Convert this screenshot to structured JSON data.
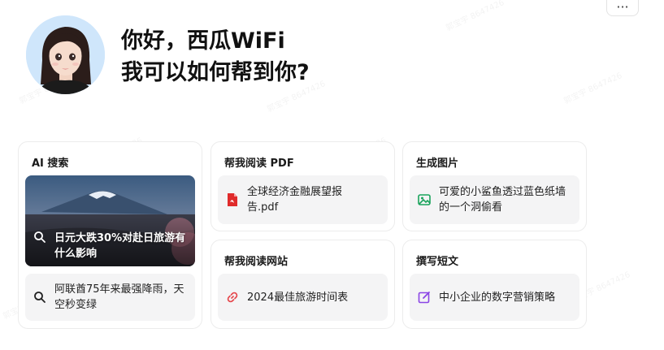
{
  "header": {
    "greeting_line1": "你好，西瓜WiFi",
    "greeting_line2": "我可以如何帮到你?",
    "more_label": "···"
  },
  "cards": {
    "ai_search": {
      "title": "AI 搜索",
      "featured": "日元大跌30%对赴日旅游有什么影响",
      "item": "阿联酋75年来最强降雨，天空秒变绿"
    },
    "read_pdf": {
      "title": "帮我阅读 PDF",
      "item": "全球经济金融展望报告.pdf"
    },
    "gen_image": {
      "title": "生成图片",
      "item": "可爱的小鲨鱼透过蓝色纸墙的一个洞偷看"
    },
    "read_web": {
      "title": "帮我阅读网站",
      "item": "2024最佳旅游时间表"
    },
    "write_short": {
      "title": "撰写短文",
      "item": "中小企业的数字营销策略"
    }
  },
  "watermark": "郭宝宇 8647426",
  "colors": {
    "pdf_red": "#e02b2b",
    "image_green": "#1aa35c",
    "link_red": "#e5484d",
    "edit_purple": "#8b45e5"
  }
}
